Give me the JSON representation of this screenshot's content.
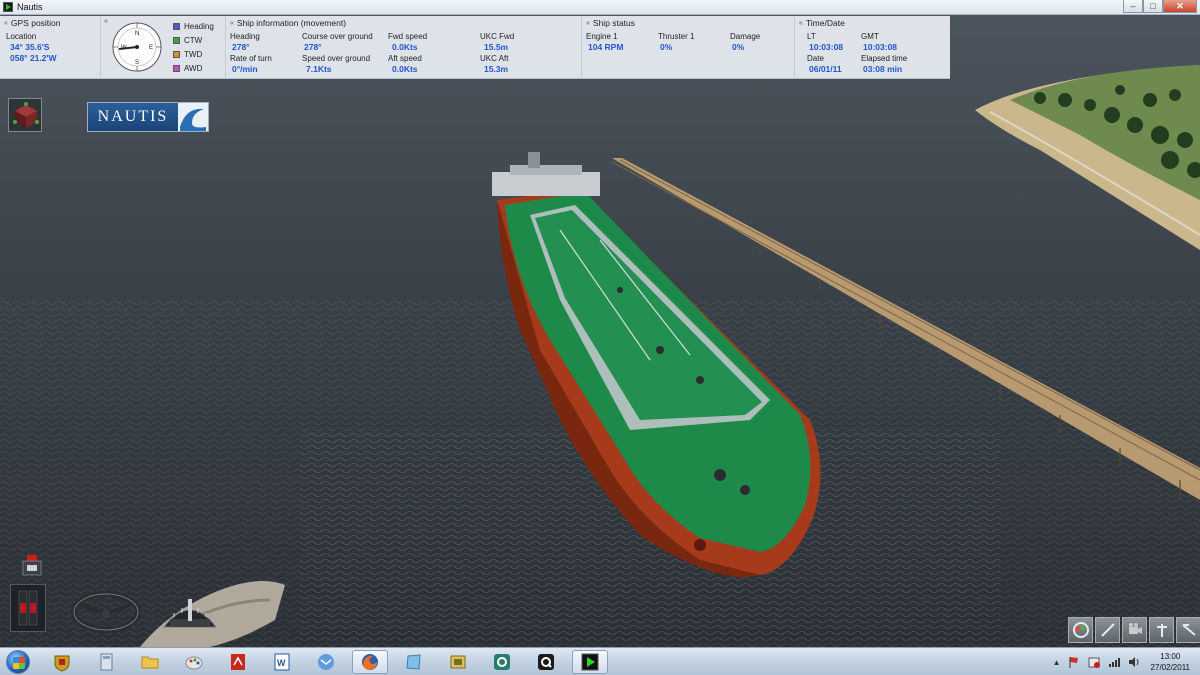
{
  "window": {
    "title": "Nautis"
  },
  "gps": {
    "title": "GPS position",
    "location_label": "Location",
    "lat": "34° 35.6'S",
    "lon": "058° 21.2'W"
  },
  "compass": {
    "legend": [
      {
        "label": "Heading",
        "color": "#4a5bd6"
      },
      {
        "label": "CTW",
        "color": "#3aa83a"
      },
      {
        "label": "TWD",
        "color": "#e08a2a"
      },
      {
        "label": "AWD",
        "color": "#d048c8"
      }
    ]
  },
  "ship": {
    "title": "Ship information (movement)",
    "heading_label": "Heading",
    "heading": "278°",
    "cog_label": "Course over ground",
    "cog": "278°",
    "fwd_speed_label": "Fwd speed",
    "fwd_speed": "0.0Kts",
    "ukc_fwd_label": "UKC Fwd",
    "ukc_fwd": "15.5m",
    "rot_label": "Rate of turn",
    "rot": "0°/min",
    "sog_label": "Speed over ground",
    "sog": "7.1Kts",
    "aft_speed_label": "Aft speed",
    "aft_speed": "0.0Kts",
    "ukc_aft_label": "UKC Aft",
    "ukc_aft": "15.3m"
  },
  "status": {
    "title": "Ship status",
    "engine_label": "Engine 1",
    "engine": "104 RPM",
    "thruster_label": "Thruster 1",
    "thruster": "0%",
    "damage_label": "Damage",
    "damage": "0%"
  },
  "time": {
    "title": "Time/Date",
    "lt_label": "LT",
    "lt": "10:03:08",
    "gmt_label": "GMT",
    "gmt": "10:03:08",
    "date_label": "Date",
    "date": "06/01/11",
    "elapsed_label": "Elapsed time",
    "elapsed": "03:08 min"
  },
  "logo": {
    "text": "NAUTIS"
  },
  "clock": {
    "time": "13:00",
    "date": "27/02/2011"
  }
}
